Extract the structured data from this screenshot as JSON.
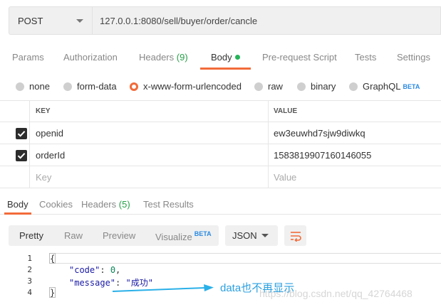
{
  "request": {
    "method": "POST",
    "url": "127.0.0.1:8080/sell/buyer/order/cancle"
  },
  "request_tabs": [
    {
      "label": "Params"
    },
    {
      "label": "Authorization"
    },
    {
      "label": "Headers",
      "count": "(9)"
    },
    {
      "label": "Body"
    },
    {
      "label": "Pre-request Script"
    },
    {
      "label": "Tests"
    },
    {
      "label": "Settings"
    }
  ],
  "body_types": [
    {
      "label": "none"
    },
    {
      "label": "form-data"
    },
    {
      "label": "x-www-form-urlencoded"
    },
    {
      "label": "raw"
    },
    {
      "label": "binary"
    },
    {
      "label": "GraphQL",
      "badge": "BETA"
    }
  ],
  "kv_table": {
    "headers": {
      "key": "KEY",
      "value": "VALUE"
    },
    "rows": [
      {
        "key": "openid",
        "value": "ew3euwhd7sjw9diwkq",
        "checked": true
      },
      {
        "key": "orderId",
        "value": "1583819907160146055",
        "checked": true
      }
    ],
    "placeholder": {
      "key": "Key",
      "value": "Value"
    }
  },
  "response_tabs": [
    {
      "label": "Body"
    },
    {
      "label": "Cookies"
    },
    {
      "label": "Headers",
      "count": "(5)"
    },
    {
      "label": "Test Results"
    }
  ],
  "view_modes": [
    {
      "label": "Pretty"
    },
    {
      "label": "Raw"
    },
    {
      "label": "Preview"
    },
    {
      "label": "Visualize",
      "badge": "BETA"
    }
  ],
  "format": "JSON",
  "code": {
    "line_numbers": [
      "1",
      "2",
      "3",
      "4"
    ],
    "open_brace": "{",
    "code_key": "\"code\"",
    "code_value": "0",
    "message_key": "\"message\"",
    "message_value": "\"成功\"",
    "close_brace": "}"
  },
  "annotation": "data也不再显示",
  "watermark": "https://blog.csdn.net/qq_42764468",
  "colors": {
    "accent": "#f26b3a",
    "active_dot": "#26b45a",
    "count_green": "#26a048",
    "beta_blue": "#2a8ae2",
    "annotation_blue": "#2a9fe0"
  }
}
